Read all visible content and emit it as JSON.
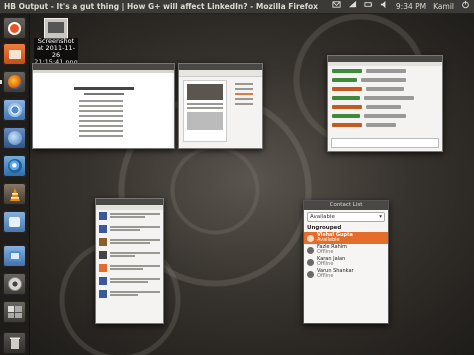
{
  "window_title": "HB Output - It's a gut thing | How G+ will affect LinkedIn? - Mozilla Firefox",
  "tray": {
    "time": "9:34 PM",
    "user": "Kamil"
  },
  "desktop": {
    "file_label": "Screenshot at 2011-11-26 21:15:41.png"
  },
  "launcher_items": [
    {
      "name": "dash-button",
      "color": "#e95420"
    },
    {
      "name": "files-button",
      "color": "#d9652b"
    },
    {
      "name": "firefox-button",
      "color": "#e66000"
    },
    {
      "name": "chromium-button",
      "color": "#4a8ad0"
    },
    {
      "name": "thunderbird-button",
      "color": "#3d7ec4"
    },
    {
      "name": "browser-button",
      "color": "#2f86c7"
    },
    {
      "name": "vlc-button",
      "color": "#f08a00"
    },
    {
      "name": "software-center-button",
      "color": "#5a9ad6"
    },
    {
      "name": "update-button",
      "color": "#4d8ed0"
    },
    {
      "name": "settings-button",
      "color": "#c9c6c0"
    },
    {
      "name": "workspace-button",
      "color": "#a9a6a0"
    }
  ],
  "contact_list": {
    "title": "Contact List",
    "status": "Available",
    "group": "Ungrouped",
    "contacts": [
      {
        "name": "Vishal Gupta",
        "status": "Available",
        "selected": true
      },
      {
        "name": "Fazle Rahim",
        "status": "Offline",
        "selected": false
      },
      {
        "name": "Karan Jalan",
        "status": "Offline",
        "selected": false
      },
      {
        "name": "Varun Shankar",
        "status": "Offline",
        "selected": false
      }
    ]
  }
}
